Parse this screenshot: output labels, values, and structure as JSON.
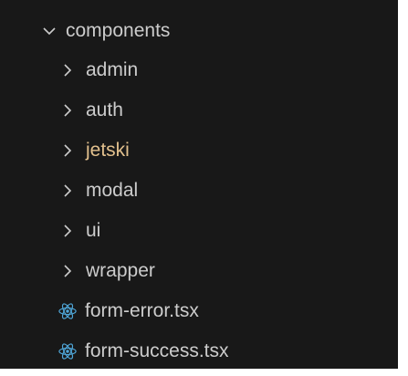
{
  "explorer": {
    "root_folder": {
      "label": "components",
      "expanded": true,
      "icon": "chevron-down-icon"
    },
    "folders": [
      {
        "label": "admin",
        "icon": "chevron-right-icon",
        "color": "#cccccc"
      },
      {
        "label": "auth",
        "icon": "chevron-right-icon",
        "color": "#cccccc"
      },
      {
        "label": "jetski",
        "icon": "chevron-right-icon",
        "color": "#e2c08d"
      },
      {
        "label": "modal",
        "icon": "chevron-right-icon",
        "color": "#cccccc"
      },
      {
        "label": "ui",
        "icon": "chevron-right-icon",
        "color": "#cccccc"
      },
      {
        "label": "wrapper",
        "icon": "chevron-right-icon",
        "color": "#cccccc"
      }
    ],
    "files": [
      {
        "label": "form-error.tsx",
        "icon": "react-icon",
        "color": "#cccccc"
      },
      {
        "label": "form-success.tsx",
        "icon": "react-icon",
        "color": "#cccccc"
      }
    ],
    "colors": {
      "background": "#181818",
      "text": "#cccccc",
      "modified_folder": "#e2c08d",
      "react_icon": "#4fa6d8"
    }
  }
}
